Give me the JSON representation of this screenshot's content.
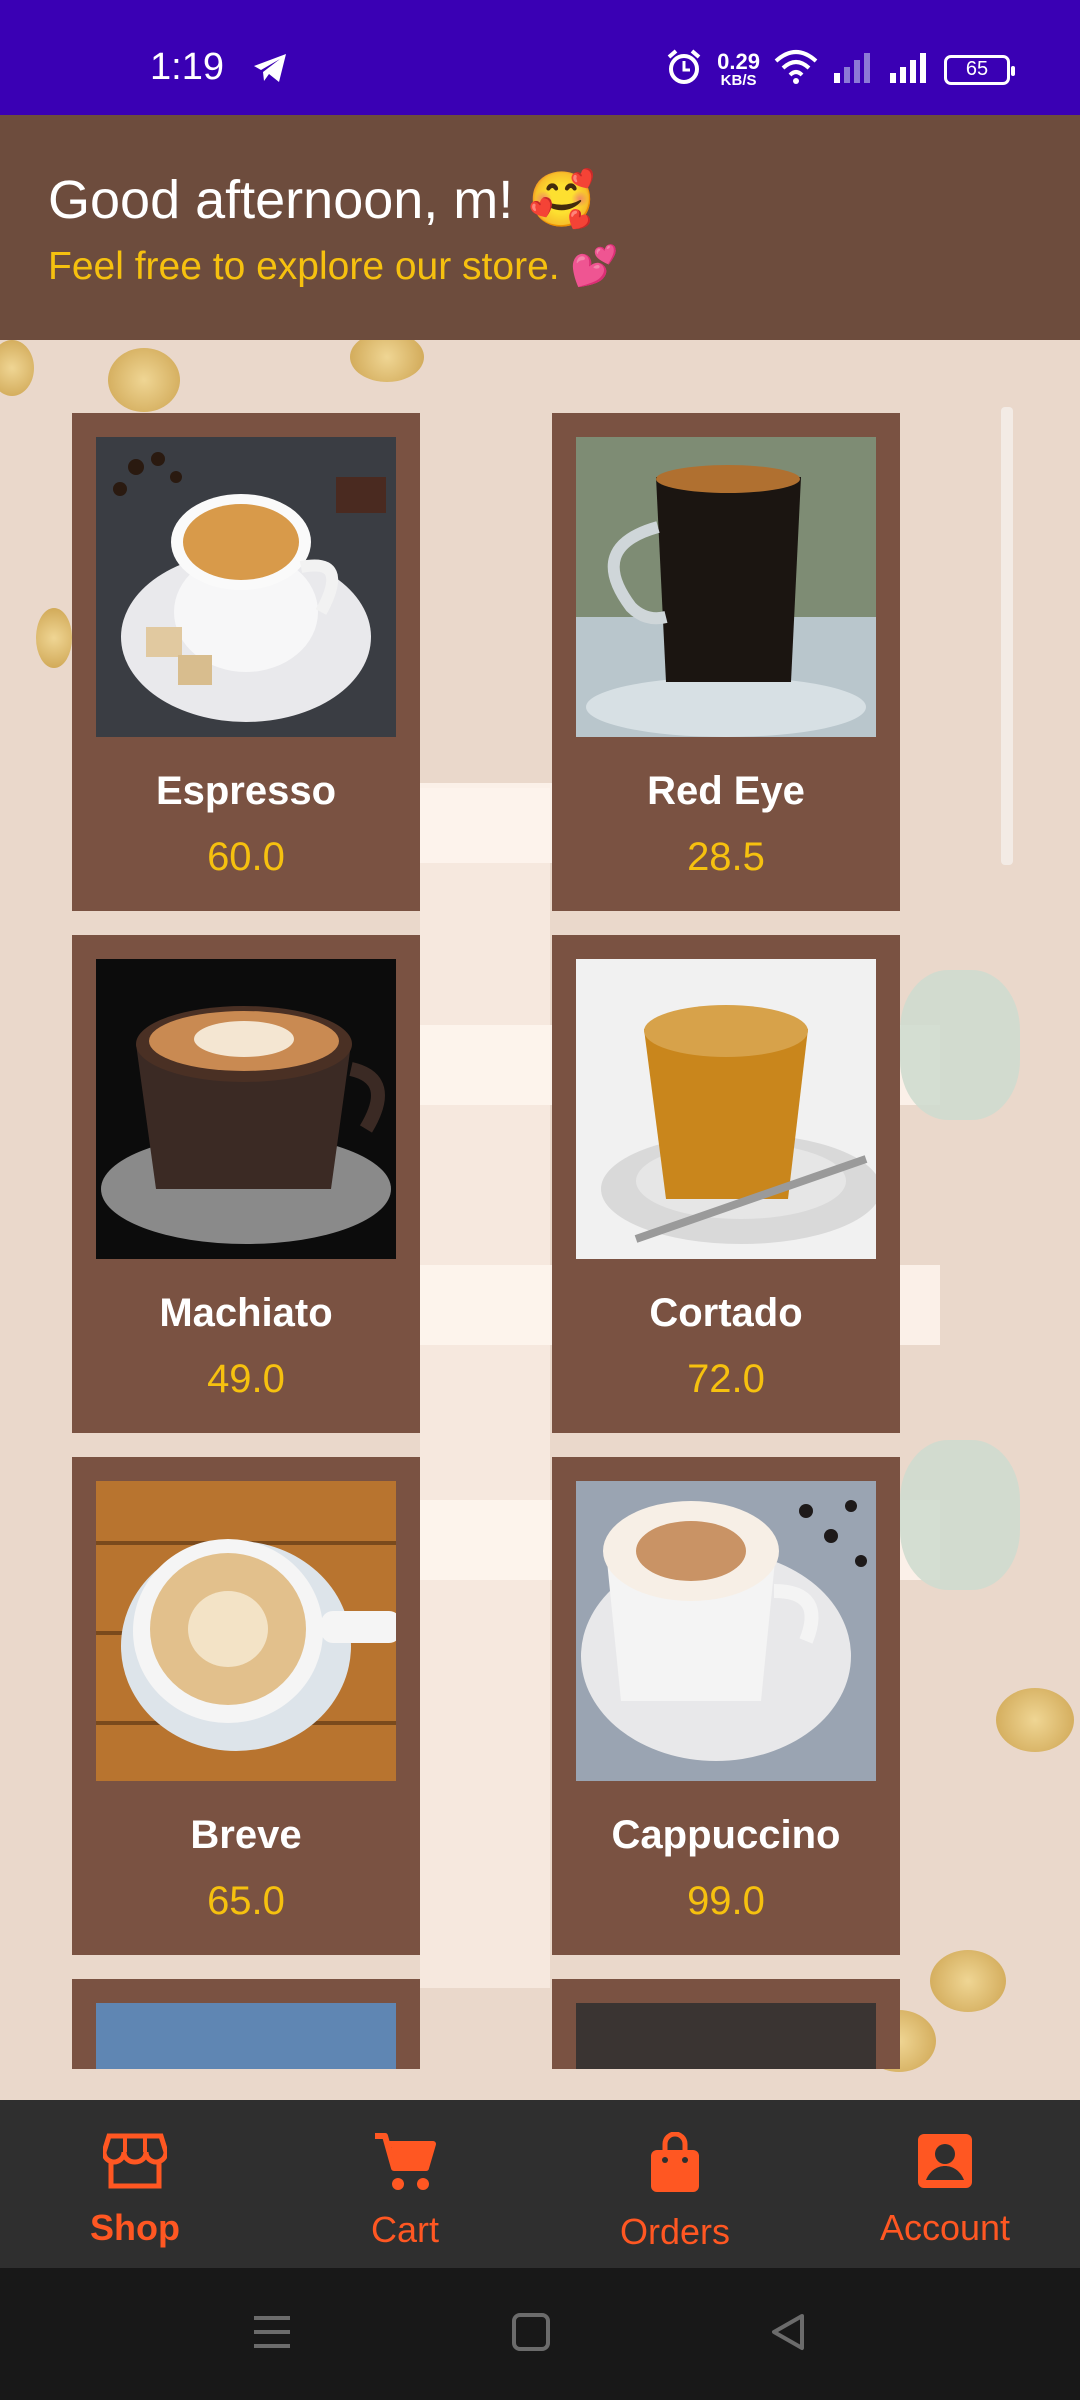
{
  "status": {
    "time": "1:19",
    "speed_value": "0.29",
    "speed_unit": "KB/S",
    "battery": "65"
  },
  "header": {
    "greeting": "Good afternoon, m! 🥰",
    "subtitle": "Feel free to explore our store. 💕"
  },
  "products": [
    {
      "name": "Espresso",
      "price": "60.0"
    },
    {
      "name": "Red Eye",
      "price": "28.5"
    },
    {
      "name": "Machiato",
      "price": "49.0"
    },
    {
      "name": "Cortado",
      "price": "72.0"
    },
    {
      "name": "Breve",
      "price": "65.0"
    },
    {
      "name": "Cappuccino",
      "price": "99.0"
    }
  ],
  "nav": {
    "items": [
      {
        "label": "Shop",
        "icon": "store-icon",
        "active": true
      },
      {
        "label": "Cart",
        "icon": "cart-icon"
      },
      {
        "label": "Orders",
        "icon": "shopping-bag-icon"
      },
      {
        "label": "Account",
        "icon": "account-icon"
      }
    ]
  },
  "colors": {
    "statusbar": "#3a00b4",
    "header": "#6d4c3d",
    "card": "#7a5242",
    "accent": "#ff5722",
    "price": "#f6c10f",
    "background": "#ead8cb"
  }
}
